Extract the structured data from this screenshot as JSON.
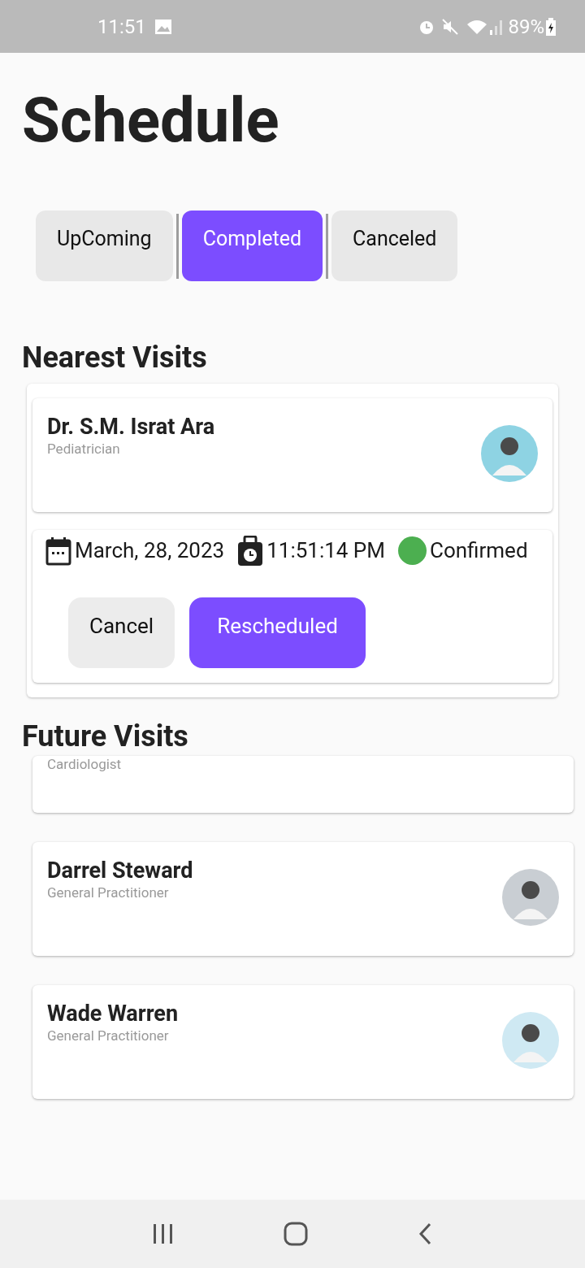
{
  "status_bar": {
    "time": "11:51",
    "battery": "89%"
  },
  "title": "Schedule",
  "tabs": [
    {
      "label": "UpComing",
      "selected": false
    },
    {
      "label": "Completed",
      "selected": true
    },
    {
      "label": "Canceled",
      "selected": false
    }
  ],
  "nearest": {
    "heading": "Nearest Visits",
    "doctor": {
      "name": "Dr. S.M. Israt Ara",
      "specialty": "Pediatrician"
    },
    "date": "March, 28, 2023",
    "time": "11:51:14 PM",
    "status": {
      "label": "Confirmed",
      "color": "#4caf50"
    },
    "buttons": [
      {
        "label": "Cancel",
        "kind": "secondary"
      },
      {
        "label": "Rescheduled",
        "kind": "primary"
      }
    ]
  },
  "future": {
    "heading": "Future Visits",
    "doctors": [
      {
        "specialty": "Cardiologist"
      },
      {
        "name": "Darrel Steward",
        "specialty": "General Practitioner"
      },
      {
        "name": "Wade Warren",
        "specialty": "General Practitioner"
      }
    ]
  }
}
